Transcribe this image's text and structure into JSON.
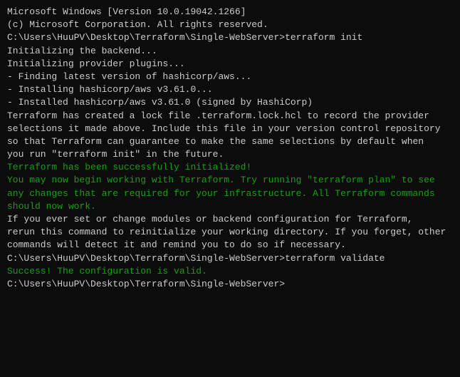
{
  "terminal": {
    "lines": [
      {
        "text": "Microsoft Windows [Version 10.0.19042.1266]",
        "color": "white"
      },
      {
        "text": "(c) Microsoft Corporation. All rights reserved.",
        "color": "white"
      },
      {
        "text": "",
        "color": "white"
      },
      {
        "text": "C:\\Users\\HuuPV\\Desktop\\Terraform\\Single-WebServer>terraform init",
        "color": "white"
      },
      {
        "text": "",
        "color": "white"
      },
      {
        "text": "Initializing the backend...",
        "color": "white"
      },
      {
        "text": "",
        "color": "white"
      },
      {
        "text": "Initializing provider plugins...",
        "color": "white"
      },
      {
        "text": "- Finding latest version of hashicorp/aws...",
        "color": "white"
      },
      {
        "text": "- Installing hashicorp/aws v3.61.0...",
        "color": "white"
      },
      {
        "text": "- Installed hashicorp/aws v3.61.0 (signed by HashiCorp)",
        "color": "white"
      },
      {
        "text": "",
        "color": "white"
      },
      {
        "text": "Terraform has created a lock file .terraform.lock.hcl to record the provider\nselections it made above. Include this file in your version control repository\nso that Terraform can guarantee to make the same selections by default when\nyou run \"terraform init\" in the future.",
        "color": "white"
      },
      {
        "text": "",
        "color": "white"
      },
      {
        "text": "Terraform has been successfully initialized!",
        "color": "green"
      },
      {
        "text": "",
        "color": "white"
      },
      {
        "text": "You may now begin working with Terraform. Try running \"terraform plan\" to see\nany changes that are required for your infrastructure. All Terraform commands\nshould now work.",
        "color": "green"
      },
      {
        "text": "",
        "color": "white"
      },
      {
        "text": "If you ever set or change modules or backend configuration for Terraform,\nrerun this command to reinitialize your working directory. If you forget, other\ncommands will detect it and remind you to do so if necessary.",
        "color": "white"
      },
      {
        "text": "",
        "color": "white"
      },
      {
        "text": "C:\\Users\\HuuPV\\Desktop\\Terraform\\Single-WebServer>terraform validate",
        "color": "white"
      },
      {
        "text": "Success! The configuration is valid.",
        "color": "green"
      },
      {
        "text": "",
        "color": "white"
      },
      {
        "text": "",
        "color": "white"
      },
      {
        "text": "C:\\Users\\HuuPV\\Desktop\\Terraform\\Single-WebServer>",
        "color": "white"
      }
    ]
  }
}
